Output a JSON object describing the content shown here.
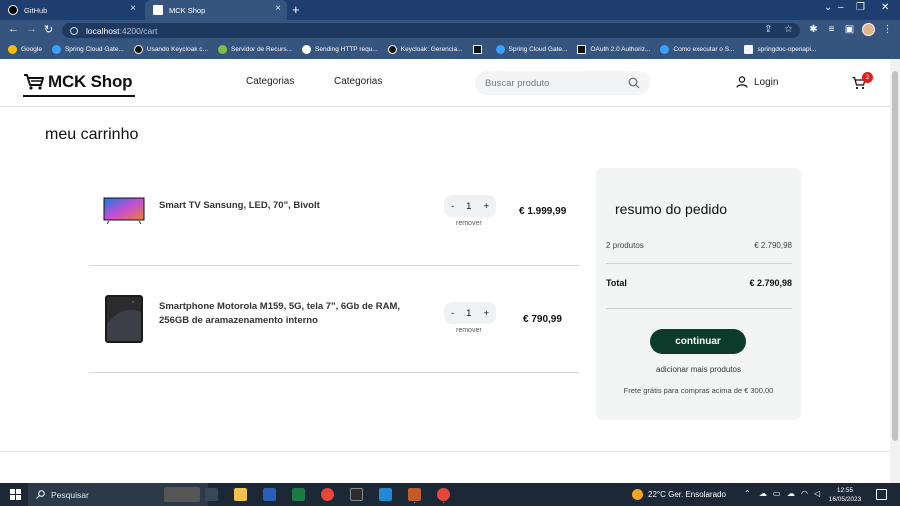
{
  "browser": {
    "tabs": [
      {
        "title": "GitHub",
        "active": false
      },
      {
        "title": "MCK Shop",
        "active": true
      }
    ],
    "url_host": "localhost",
    "url_path": ":4200/cart",
    "bookmarks": [
      {
        "label": "Google",
        "color": "#fbbc05"
      },
      {
        "label": "Spring Cloud Gate...",
        "color": "#3aa0ff"
      },
      {
        "label": "Usando Keycloak c...",
        "color": "#111111"
      },
      {
        "label": "Servidor de Recurs...",
        "color": "#7cc242"
      },
      {
        "label": "Sending HTTP requ...",
        "color": "#ffffff"
      },
      {
        "label": "Keycloak: Gerencia...",
        "color": "#111111"
      },
      {
        "label": "",
        "color": "#111111"
      },
      {
        "label": "Spring Cloud Gate...",
        "color": "#3aa0ff"
      },
      {
        "label": "OAuth 2.0 Authoriz...",
        "color": "#111111"
      },
      {
        "label": "Como executar o S...",
        "color": "#3aa0ff"
      },
      {
        "label": "springdoc-openapi...",
        "color": "#f4f4f4"
      }
    ]
  },
  "header": {
    "logo": "MCK Shop",
    "nav": [
      "Categorias",
      "Categorias"
    ],
    "search_placeholder": "Buscar produto",
    "login": "Login",
    "cart_count": "2"
  },
  "cart": {
    "title": "meu carrinho",
    "items": [
      {
        "name": "Smart TV Sansung, LED, 70\", Bivolt",
        "qty": "1",
        "remove": "remover",
        "price": "€ 1.999,99"
      },
      {
        "name": "Smartphone Motorola M159, 5G, tela 7\", 6Gb de RAM, 256GB de aramazenamento interno",
        "qty": "1",
        "remove": "remover",
        "price": "€ 790,99"
      }
    ],
    "qty_minus": "-",
    "qty_plus": "+"
  },
  "summary": {
    "title": "resumo do pedido",
    "products_label": "2 produtos",
    "products_value": "€ 2.790,98",
    "total_label": "Total",
    "total_value": "€ 2.790,98",
    "continue": "continuar",
    "more": "adicionar mais produtos",
    "freight": "Frete grátis para compras acima de € 300,00"
  },
  "taskbar": {
    "search": "Pesquisar",
    "weather": "22°C  Ger. Ensolarado",
    "time": "12:55",
    "date": "16/05/2023"
  }
}
